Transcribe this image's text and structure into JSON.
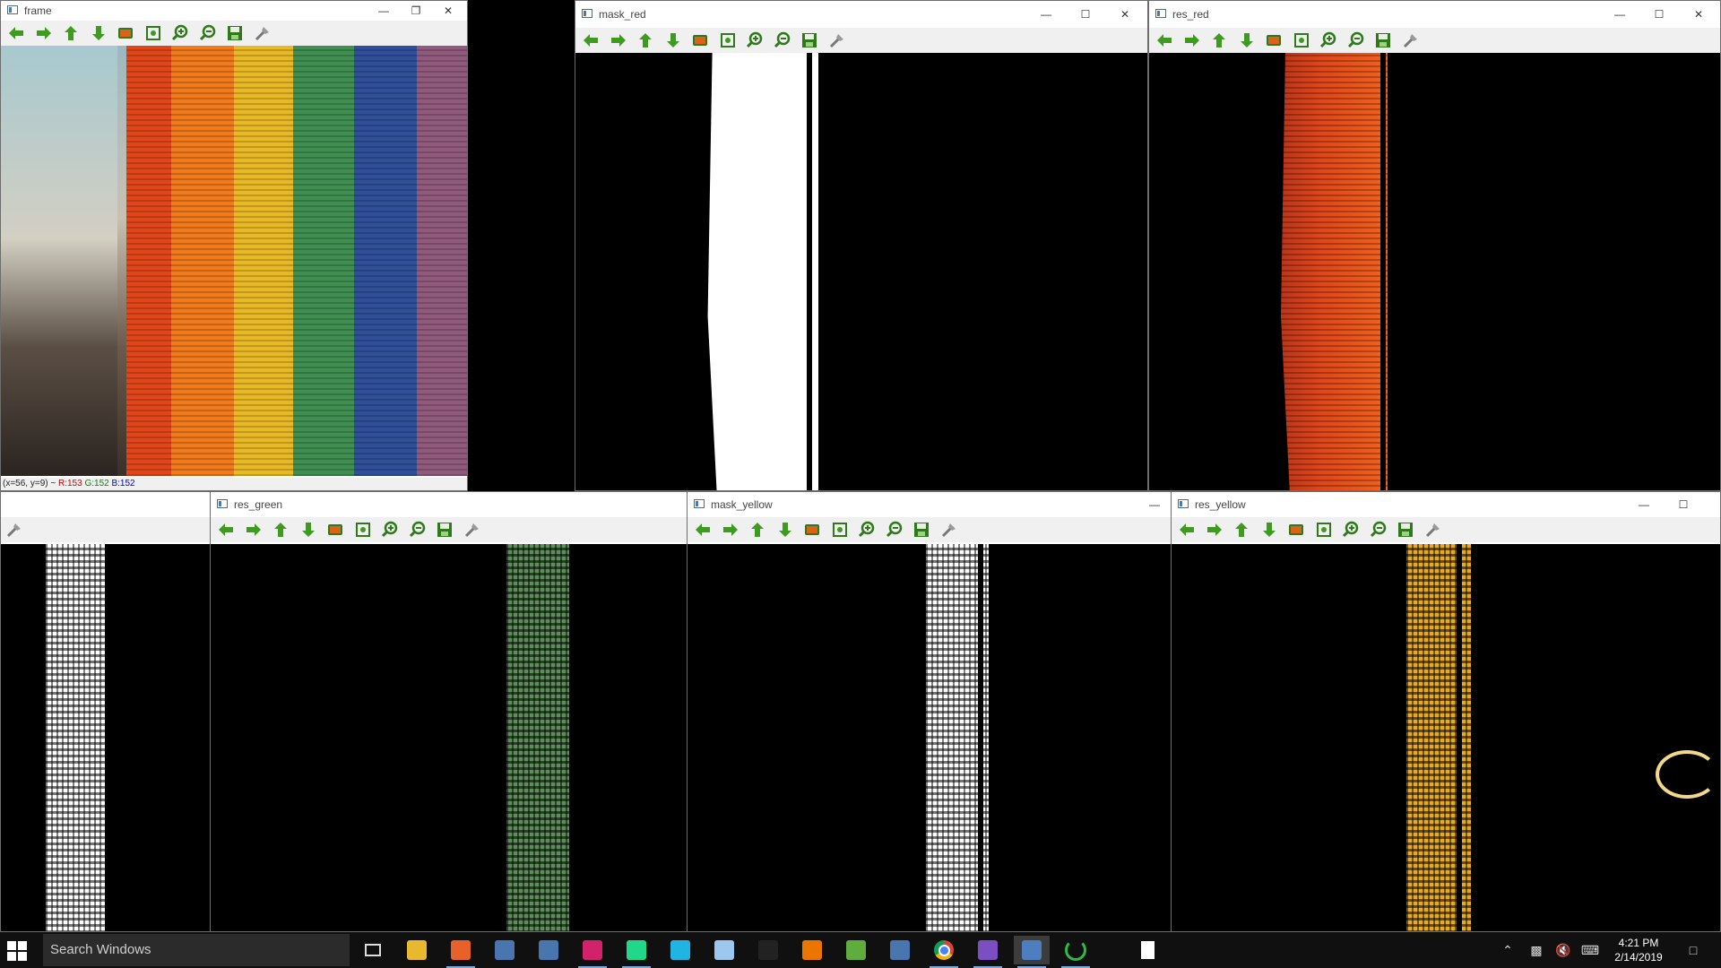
{
  "windows": {
    "frame": {
      "title": "frame",
      "status": "(x=56, y=9) ~ ",
      "status_r": "R:153",
      "status_g": "G:152",
      "status_b": "B:152"
    },
    "mask_red": {
      "title": "mask_red"
    },
    "res_red": {
      "title": "res_red"
    },
    "res_green": {
      "title": "res_green"
    },
    "mask_yellow": {
      "title": "mask_yellow"
    },
    "res_yellow": {
      "title": "res_yellow"
    }
  },
  "toolbar_icons": [
    "arrow-left-icon",
    "arrow-right-icon",
    "arrow-up-icon",
    "arrow-down-icon",
    "image-icon",
    "zoom-fit-icon",
    "zoom-in-icon",
    "zoom-out-icon",
    "save-icon",
    "properties-icon"
  ],
  "taskbar": {
    "search_placeholder": "Search Windows",
    "time": "4:21 PM",
    "date": "2/14/2019",
    "apps": [
      "task-view-icon",
      "file-explorer-icon",
      "firefox-icon",
      "app-icon",
      "app-icon",
      "intellij-icon",
      "pycharm-icon",
      "webstorm-icon",
      "cube-icon",
      "unity-icon",
      "blender-icon",
      "notepad-icon",
      "app-icon",
      "chrome-icon",
      "visual-studio-icon",
      "network-app-icon",
      "spinner-app-icon",
      "document-icon"
    ]
  },
  "colors": {
    "toolbar_green": "#3f9b1f",
    "red_stripe": "#e0461a",
    "orange_stripe": "#f07a1c",
    "yellow_stripe": "#e8b826",
    "green_stripe": "#3f8f52",
    "blue_stripe": "#2f4f9a",
    "purple_stripe": "#8f5a7c",
    "res_green": "#5d8f58",
    "res_yellow": "#e8a923"
  }
}
